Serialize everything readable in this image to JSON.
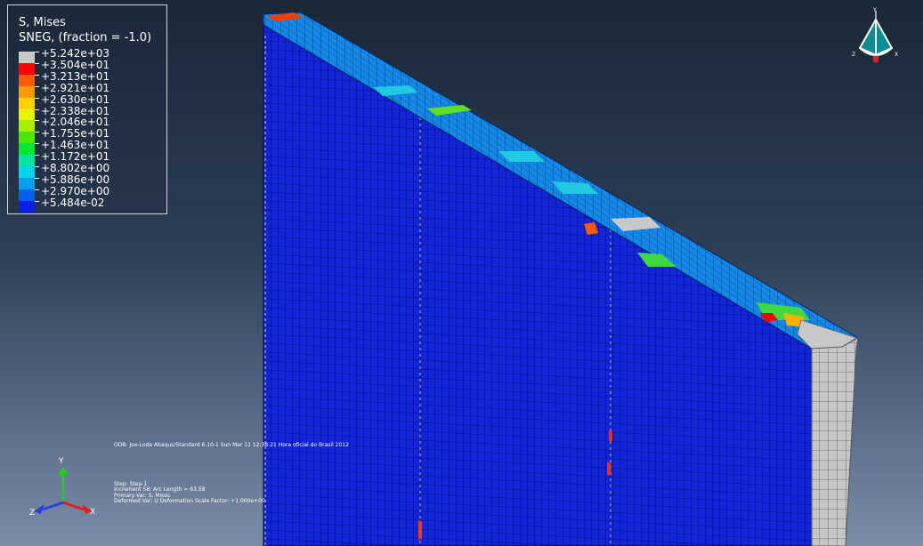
{
  "legend": {
    "title": "S, Mises",
    "subtitle": "SNEG, (fraction = -1.0)",
    "entries": [
      {
        "label": "+5.242e+03",
        "color": "#c9c9c9"
      },
      {
        "label": "+3.504e+01",
        "color": "#ff0000"
      },
      {
        "label": "+3.213e+01",
        "color": "#ff5a00"
      },
      {
        "label": "+2.921e+01",
        "color": "#ff9a00"
      },
      {
        "label": "+2.630e+01",
        "color": "#ffd200"
      },
      {
        "label": "+2.338e+01",
        "color": "#e6f500"
      },
      {
        "label": "+2.046e+01",
        "color": "#a4f000"
      },
      {
        "label": "+1.755e+01",
        "color": "#4ce600"
      },
      {
        "label": "+1.463e+01",
        "color": "#00e632"
      },
      {
        "label": "+1.172e+01",
        "color": "#00e6a0"
      },
      {
        "label": "+8.802e+00",
        "color": "#00d6e6"
      },
      {
        "label": "+5.886e+00",
        "color": "#00a0f0"
      },
      {
        "label": "+2.970e+00",
        "color": "#0060f0"
      },
      {
        "label": "+5.484e-02",
        "color": "#0a1ee6"
      }
    ],
    "ticks": [
      "",
      "",
      "",
      "",
      "",
      "",
      "",
      "",
      "",
      "",
      "",
      "",
      "",
      ""
    ]
  },
  "info": {
    "odb_line": "ODB: Joe-Loda    Abaqus/Standard 6.10-1    Sun Mar 11 12:38:21 Hora oficial do Brasil 2012",
    "step_line": "Step: Step-1",
    "increment_line": "Increment     58: Arc Length =     63.58",
    "primary_var_line": "Primary Var: S, Mises",
    "deformed_var_line": "Deformed Var: U   Deformation Scale Factor: +1.000e+00"
  },
  "triad": {
    "x": "X",
    "y": "Y",
    "z": "Z"
  },
  "view_triad": {
    "x": "X",
    "y": "Y",
    "z": "Z"
  },
  "colors": {
    "mesh_face": "#1226d8",
    "mesh_line": "#00006a",
    "high_stress": "#c8c8c8"
  }
}
